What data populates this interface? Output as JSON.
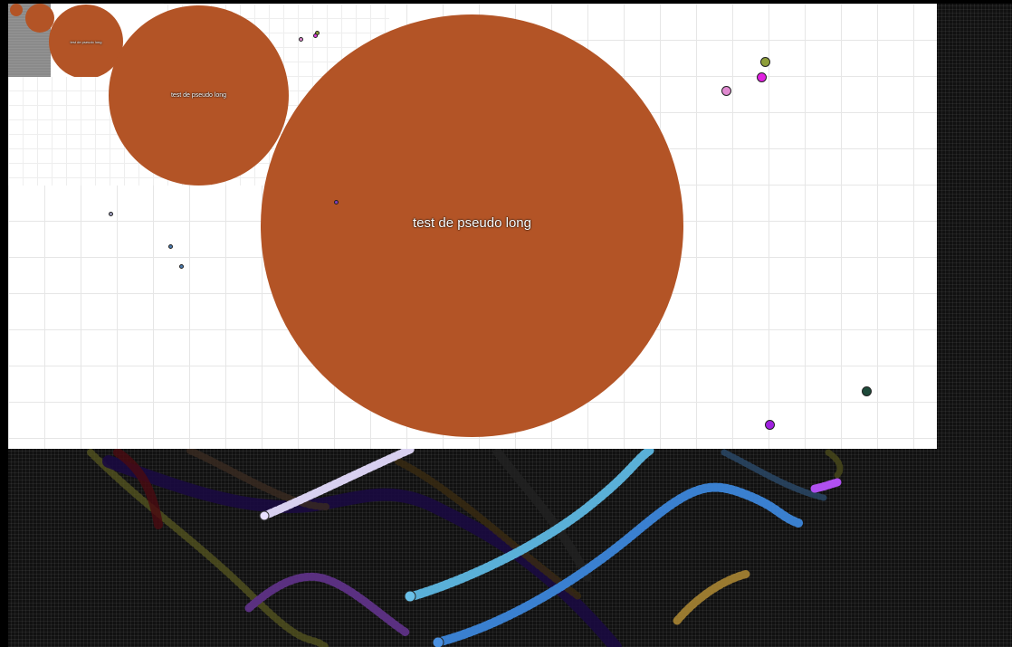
{
  "player": {
    "nickname": "test de pseudo long",
    "cell_color": "#b35426"
  },
  "colors": {
    "background_dark": "#111111",
    "grid_light": "#e6e6e6"
  },
  "pellet_colors": [
    "#8e9e3a",
    "#e040e0",
    "#e08ad0",
    "#1e4a3a",
    "#a040e0",
    "#4a7ab0",
    "#8040c0",
    "#a0a0c0"
  ],
  "trail_colors": [
    "#d8d0f0",
    "#5ab0d8",
    "#3a80d0",
    "#a040e0",
    "#9a7a30",
    "#5a3080"
  ]
}
